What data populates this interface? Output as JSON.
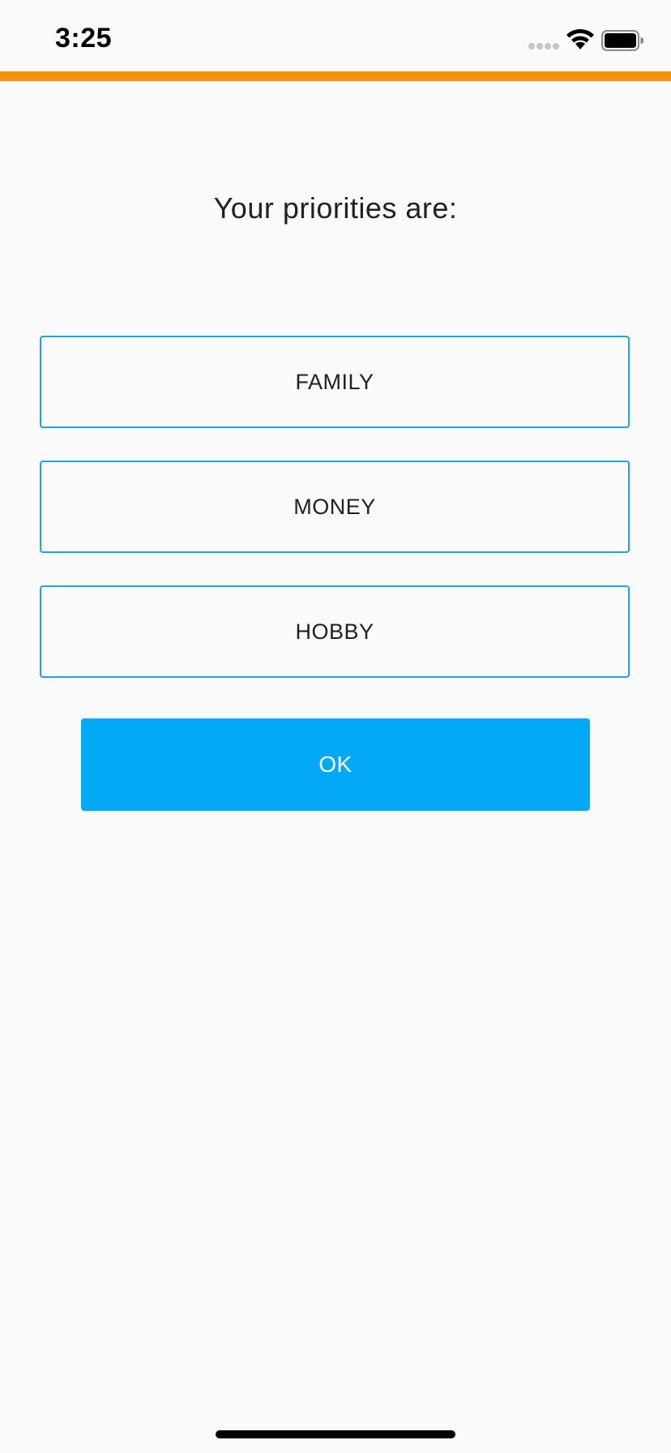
{
  "status_bar": {
    "time": "3:25",
    "signal_icon": "cellular-signal-dots-icon",
    "wifi_icon": "wifi-icon",
    "battery_icon": "battery-icon"
  },
  "colors": {
    "accent_bar": "#f5930c",
    "box_border": "#1ca6e0",
    "ok_button": "#03a9f4",
    "background": "#fafafa"
  },
  "title": "Your priorities are:",
  "priorities": [
    "FAMILY",
    "MONEY",
    "HOBBY"
  ],
  "ok_button": {
    "label": "OK"
  }
}
